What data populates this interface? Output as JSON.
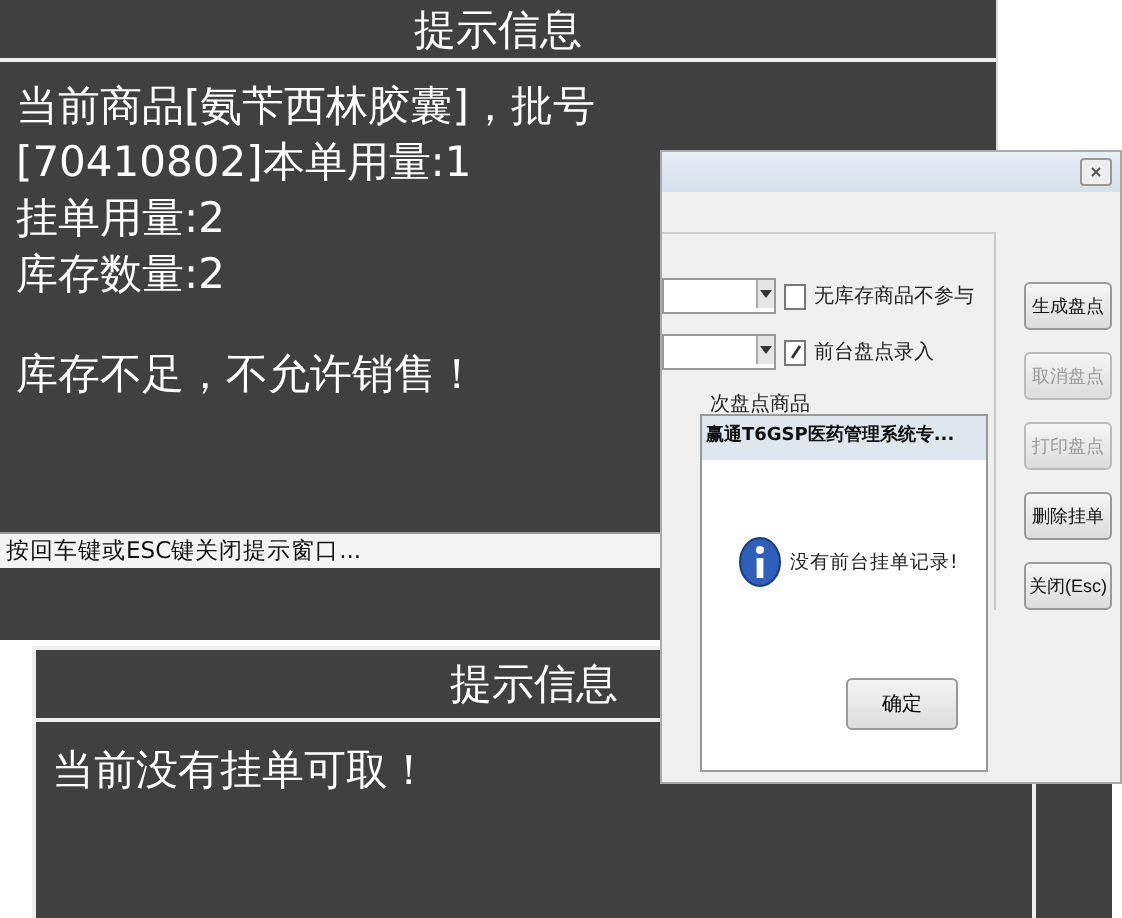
{
  "alert_top": {
    "title": "提示信息",
    "lines": [
      "当前商品[氨苄西林胶囊]，批号",
      "[70410802]本单用量:1",
      "挂单用量:2",
      "库存数量:2"
    ],
    "warning": "库存不足，不允许销售！",
    "status": "按回车键或ESC键关闭提示窗口..."
  },
  "alert_bottom": {
    "title": "提示信息",
    "message": "当前没有挂单可取！"
  },
  "inventory_window": {
    "options": [
      {
        "label": "无库存商品不参与",
        "checked": false
      },
      {
        "label": "前台盘点录入",
        "checked": true
      }
    ],
    "partial_label": "次盘点商品",
    "buttons": [
      {
        "label": "生成盘点",
        "disabled": false
      },
      {
        "label": "取消盘点",
        "disabled": true
      },
      {
        "label": "打印盘点",
        "disabled": true
      },
      {
        "label": "删除挂单",
        "disabled": false
      },
      {
        "label": "关闭(Esc)",
        "disabled": false
      }
    ]
  },
  "message_box": {
    "title": "赢通T6GSP医药管理系统专...",
    "message": "没有前台挂单记录!",
    "button": "确定"
  }
}
